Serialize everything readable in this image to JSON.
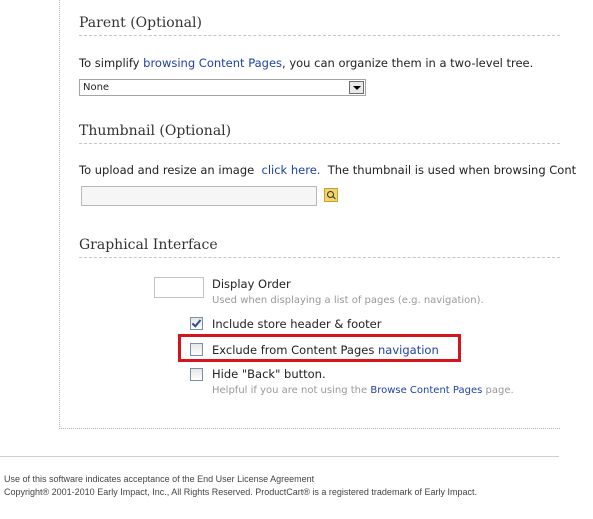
{
  "parent": {
    "title": "Parent (Optional)",
    "desc_prefix": "To simplify ",
    "desc_link": "browsing Content Pages",
    "desc_suffix": ", you can organize them in a two-level tree.",
    "select_value": "None"
  },
  "thumbnail": {
    "title": "Thumbnail (Optional)",
    "desc_prefix": "To upload and resize an image  ",
    "desc_link": "click here.",
    "desc_suffix": "  The thumbnail is used when browsing Cont",
    "input_value": "",
    "search_icon": "magnifier-icon"
  },
  "graphical": {
    "title": "Graphical Interface",
    "display_order": {
      "label": "Display Order",
      "hint": "Used when displaying a list of pages (e.g. navigation).",
      "value": ""
    },
    "include_header": {
      "label": "Include store header & footer",
      "checked": true
    },
    "exclude_nav": {
      "label_prefix": "Exclude from Content Pages ",
      "label_link": "navigation",
      "checked": false,
      "highlight_color": "#d6141c"
    },
    "hide_back": {
      "label": "Hide \"Back\" button.",
      "hint_prefix": "Helpful if you are not using the ",
      "hint_link": "Browse Content Pages",
      "hint_suffix": " page.",
      "checked": false
    }
  },
  "footer": {
    "line1": "Use of this software indicates acceptance of the End User License Agreement",
    "line2": "Copyright® 2001-2010 Early Impact, Inc., All Rights Reserved. ProductCart® is a registered trademark of Early Impact."
  },
  "colors": {
    "link": "#1f3fa8",
    "hint": "#999999",
    "highlight": "#d6141c"
  }
}
